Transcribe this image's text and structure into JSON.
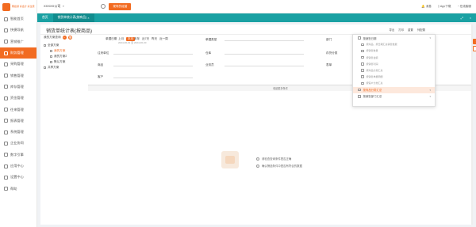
{
  "sidebar": {
    "logo_text": "畅捷通 好会计\n好生意",
    "items": [
      "智能首页",
      "快捷导航",
      "营销推广",
      "财务管理",
      "采购管理",
      "销售管理",
      "库存管理",
      "资金管理",
      "往来管理",
      "报表管理",
      "系统管理",
      "企业协同",
      "数字引擎",
      "应用中心",
      "设置中心",
      "帮助"
    ],
    "active_index": 3
  },
  "topbar": {
    "company": "XXXXX公司",
    "button": "现有的经营",
    "right": [
      "消息",
      "App下载",
      "在线客服"
    ]
  },
  "tabs": [
    "首页",
    "销货单统计表(按商品)"
  ],
  "page": {
    "title": "销货单统计表(按商品)",
    "tools": [
      "导出",
      "打印",
      "重置",
      "列配置"
    ]
  },
  "tree": {
    "header": "我的方案查询",
    "items": [
      "全部方案",
      "我的方案",
      "我的方案2",
      "共享方案",
      "默认方案"
    ]
  },
  "filters": {
    "date_label": "单据日期",
    "date_options": [
      "上月",
      "本月",
      "本年",
      "近7天",
      "昨天",
      "近一周"
    ],
    "date_range": "2024-06-01 至 2024-06-30",
    "fields": [
      "往来单位",
      "商品",
      "客户",
      "单据类型",
      "仓库",
      "业务员",
      "部门",
      "存货分类",
      "表单",
      "单据状态"
    ],
    "expand": "收起更多条件"
  },
  "actions": {
    "query": "查询",
    "reset": "重置"
  },
  "empty": {
    "hints": [
      "请检查查询条件是否正确",
      "确认筛选条件中是否有符合的数据"
    ]
  },
  "dropdown": {
    "items": [
      "按销售日期",
      "按商品、按日期汇总销售数据",
      "按销售数量",
      "按销售金额",
      "按销售利润",
      "按商品分类汇总",
      "按销售单据明细",
      "按客户分类汇总",
      "按商品分类汇总",
      "按销售部门汇总"
    ],
    "highlight_index": 8
  }
}
